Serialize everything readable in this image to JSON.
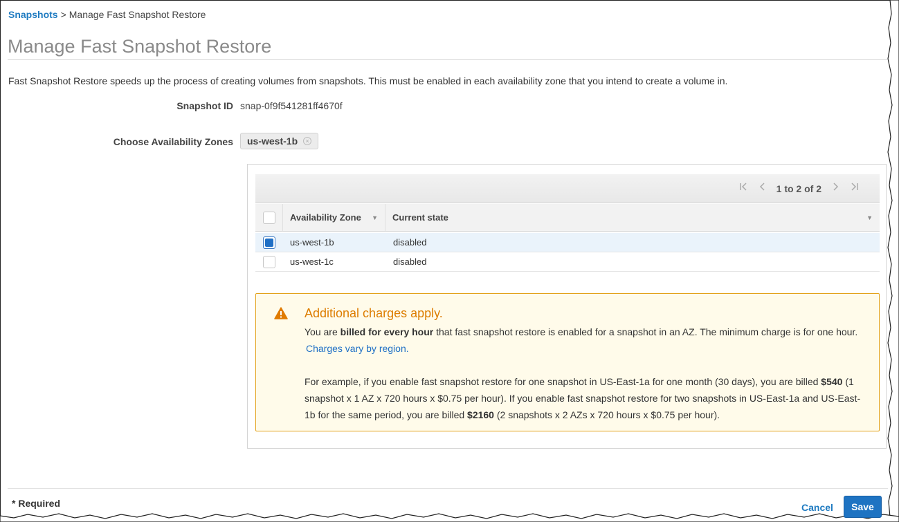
{
  "breadcrumb": {
    "link": "Snapshots",
    "separator": ">",
    "current": "Manage Fast Snapshot Restore"
  },
  "page_title": "Manage Fast Snapshot Restore",
  "description": "Fast Snapshot Restore speeds up the process of creating volumes from snapshots. This must be enabled in each availability zone that you intend to create a volume in.",
  "snapshot": {
    "label": "Snapshot ID",
    "value": "snap-0f9f541281ff4670f"
  },
  "az_select": {
    "label": "Choose Availability Zones",
    "tokens": [
      "us-west-1b"
    ],
    "remove_glyph": "×"
  },
  "pager": {
    "text": "1 to 2 of 2",
    "first_icon": "first-page-icon",
    "prev_icon": "prev-page-icon",
    "next_icon": "next-page-icon",
    "last_icon": "last-page-icon"
  },
  "table": {
    "columns": [
      "Availability Zone",
      "Current state"
    ],
    "rows": [
      {
        "zone": "us-west-1b",
        "state": "disabled",
        "selected": true
      },
      {
        "zone": "us-west-1c",
        "state": "disabled",
        "selected": false
      }
    ]
  },
  "alert": {
    "icon": "warning-icon",
    "title": "Additional charges apply.",
    "line1_pre": "You are ",
    "line1_bold": "billed for every hour",
    "line1_post": " that fast snapshot restore is enabled for a snapshot in an AZ. The minimum charge is for one hour.",
    "link": "Charges vary by region.",
    "example_pre": "For example, if you enable fast snapshot restore for one snapshot in US-East-1a for one month (30 days), you are billed ",
    "example_bold1": "$540",
    "example_mid": " (1 snapshot x 1 AZ x 720 hours x $0.75 per hour). If you enable fast snapshot restore for two snapshots in US-East-1a and US-East-1b for the same period, you are billed ",
    "example_bold2": "$2160",
    "example_post": " (2 snapshots x 2 AZs x 720 hours x $0.75 per hour)."
  },
  "footer": {
    "required": "* Required",
    "cancel": "Cancel",
    "save": "Save"
  },
  "colors": {
    "accent": "#1f7bc1",
    "save_button": "#1e73c2",
    "warning_border": "#e3a21a",
    "warning_title": "#dd7d00",
    "warning_bg": "#fffbea"
  }
}
